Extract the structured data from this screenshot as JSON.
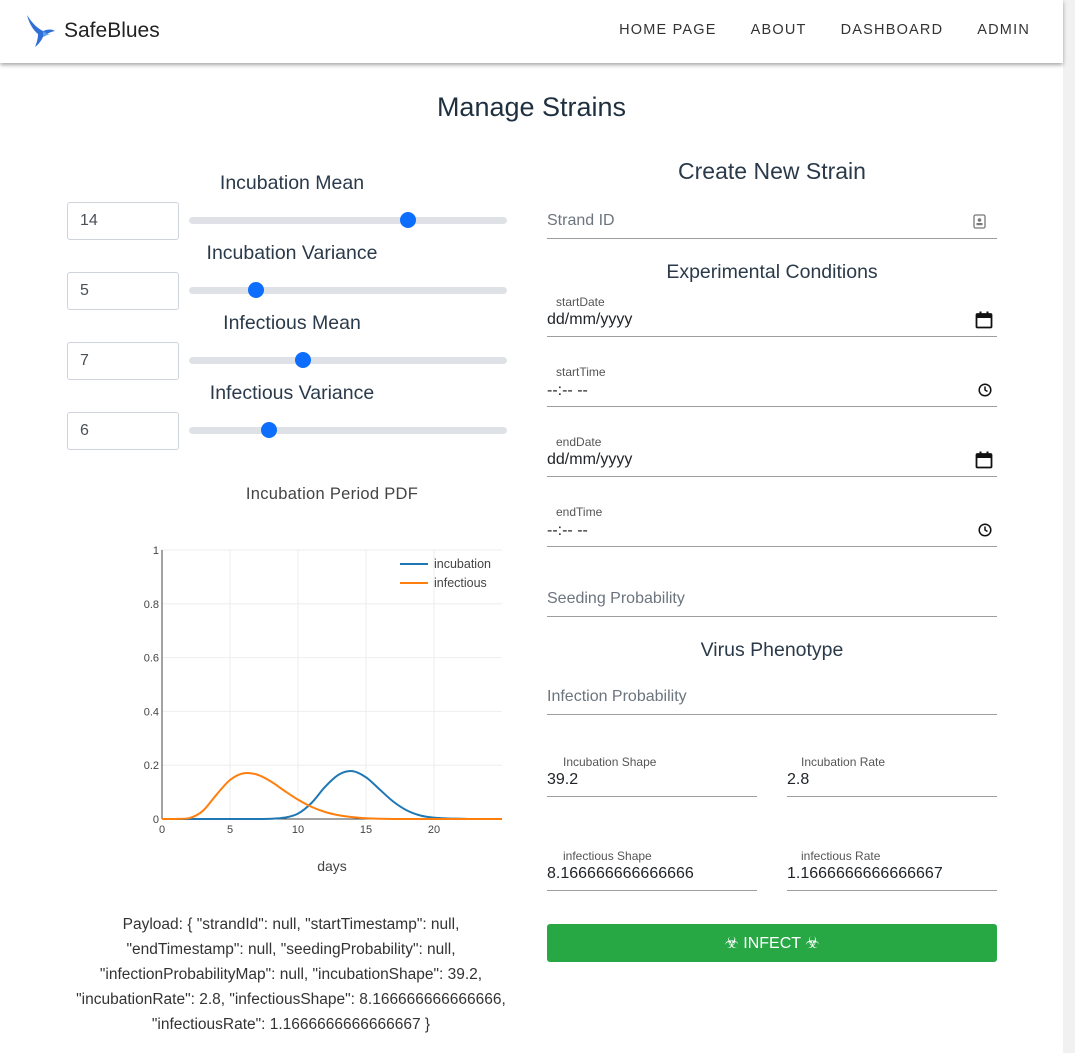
{
  "nav": {
    "brand": "SafeBlues",
    "links": [
      "HOME PAGE",
      "ABOUT",
      "DASHBOARD",
      "ADMIN"
    ]
  },
  "page_title": "Manage Strains",
  "sliders": [
    {
      "label": "Incubation Mean",
      "value": "14",
      "level": 0.69
    },
    {
      "label": "Incubation Variance",
      "value": "5",
      "level": 0.21
    },
    {
      "label": "Infectious Mean",
      "value": "7",
      "level": 0.36
    },
    {
      "label": "Infectious Variance",
      "value": "6",
      "level": 0.25
    }
  ],
  "chart_title": "Incubation Period PDF",
  "chart_data": {
    "type": "line",
    "title": "Incubation Period PDF",
    "xlabel": "days",
    "ylabel": "",
    "xlim": [
      0,
      25
    ],
    "ylim": [
      0,
      1
    ],
    "x_ticks": [
      "0",
      "5",
      "10",
      "15",
      "20"
    ],
    "y_ticks": [
      "0",
      "0.2",
      "0.4",
      "0.6",
      "0.8",
      "1"
    ],
    "legend": "top-right",
    "x": [
      0,
      1,
      2,
      3,
      4,
      5,
      6,
      7,
      8,
      9,
      10,
      11,
      12,
      13,
      14,
      15,
      16,
      17,
      18,
      19,
      20,
      21,
      22,
      23,
      24,
      25
    ],
    "series": [
      {
        "name": "incubation",
        "color": "#1f77b4",
        "values": [
          0,
          0,
          0,
          0,
          0,
          0,
          0,
          0,
          0.001,
          0.005,
          0.02,
          0.06,
          0.12,
          0.165,
          0.178,
          0.155,
          0.11,
          0.065,
          0.032,
          0.013,
          0.005,
          0.002,
          0.001,
          0,
          0,
          0
        ]
      },
      {
        "name": "infectious",
        "color": "#ff7f0e",
        "values": [
          0,
          0,
          0.003,
          0.03,
          0.09,
          0.145,
          0.17,
          0.165,
          0.14,
          0.105,
          0.072,
          0.045,
          0.026,
          0.014,
          0.007,
          0.003,
          0.001,
          0,
          0,
          0,
          0,
          0,
          0,
          0,
          0,
          0
        ]
      }
    ]
  },
  "payload_text": "Payload: { \"strandId\": null, \"startTimestamp\": null, \"endTimestamp\": null, \"seedingProbability\": null, \"infectionProbabilityMap\": null, \"incubationShape\": 39.2, \"incubationRate\": 2.8, \"infectiousShape\": 8.166666666666666, \"infectiousRate\": 1.1666666666666667 }",
  "form": {
    "title": "Create New Strain",
    "strand_id_placeholder": "Strand ID",
    "experimental_title": "Experimental Conditions",
    "start_date_label": "startDate",
    "start_date_value": "dd/mm/yyyy",
    "start_time_label": "startTime",
    "start_time_value": "--:-- --",
    "end_date_label": "endDate",
    "end_date_value": "dd/mm/yyyy",
    "end_time_label": "endTime",
    "end_time_value": "--:-- --",
    "seeding_placeholder": "Seeding Probability",
    "phenotype_title": "Virus Phenotype",
    "infection_placeholder": "Infection Probability",
    "incubation_shape_label": "Incubation Shape",
    "incubation_shape_value": "39.2",
    "incubation_rate_label": "Incubation Rate",
    "incubation_rate_value": "2.8",
    "infectious_shape_label": "infectious Shape",
    "infectious_shape_value": "8.166666666666666",
    "infectious_rate_label": "infectious Rate",
    "infectious_rate_value": "1.1666666666666667",
    "infect_button": "☣ INFECT ☣"
  },
  "colors": {
    "accent": "#0d6efd",
    "button": "#28a745",
    "incubation": "#1f77b4",
    "infectious": "#ff7f0e"
  }
}
